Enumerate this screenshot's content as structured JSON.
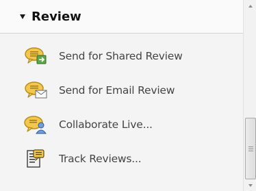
{
  "section": {
    "title": "Review",
    "expanded": true
  },
  "items": [
    {
      "label": "Send for Shared Review",
      "icon": "shared-review-icon"
    },
    {
      "label": "Send for Email Review",
      "icon": "email-review-icon"
    },
    {
      "label": "Collaborate Live...",
      "icon": "collaborate-live-icon"
    },
    {
      "label": "Track Reviews...",
      "icon": "track-reviews-icon"
    }
  ],
  "colors": {
    "bubble_yellow": "#f3c84a",
    "bubble_outline": "#b88a1c",
    "panel_bg": "#f4f4f4"
  }
}
